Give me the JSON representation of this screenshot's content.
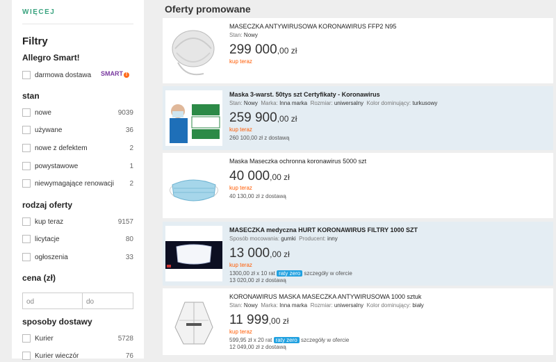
{
  "sidebar": {
    "more_link": "WIĘCEJ",
    "filters_title": "Filtry",
    "smart": {
      "title": "Allegro Smart!",
      "free_delivery_label": "darmowa dostawa",
      "smart_badge": "SMART",
      "smart_badge_mark": "!"
    },
    "condition": {
      "title": "stan",
      "items": [
        {
          "label": "nowe",
          "count": "9039"
        },
        {
          "label": "używane",
          "count": "36"
        },
        {
          "label": "nowe z defektem",
          "count": "2"
        },
        {
          "label": "powystawowe",
          "count": "1"
        },
        {
          "label": "niewymagające renowacji",
          "count": "2"
        }
      ]
    },
    "offer_type": {
      "title": "rodzaj oferty",
      "items": [
        {
          "label": "kup teraz",
          "count": "9157"
        },
        {
          "label": "licytacje",
          "count": "80"
        },
        {
          "label": "ogłoszenia",
          "count": "33"
        }
      ]
    },
    "price": {
      "title": "cena (zł)",
      "from_placeholder": "od",
      "to_placeholder": "do",
      "separator": "-"
    },
    "delivery": {
      "title": "sposoby dostawy",
      "items": [
        {
          "label": "Kurier",
          "count": "5728"
        },
        {
          "label": "Kurier wieczór",
          "count": "76"
        }
      ]
    }
  },
  "main": {
    "title": "Oferty promowane",
    "offers": [
      {
        "title": "MASECZKA ANTYWIRUSOWA KORONAWIRUS FFP2 N95",
        "attrs": [
          {
            "k": "Stan:",
            "v": "Nowy"
          }
        ],
        "price_main": "299 000",
        "price_rest": ",00 zł",
        "buy_now": "kup teraz"
      },
      {
        "title": "Maska 3-warst. 50tys szt Certyfikaty - Koronawirus",
        "attrs": [
          {
            "k": "Stan:",
            "v": "Nowy"
          },
          {
            "k": "Marka:",
            "v": "Inna marka"
          },
          {
            "k": "Rozmiar:",
            "v": "uniwersalny"
          },
          {
            "k": "Kolor dominujący:",
            "v": "turkusowy"
          }
        ],
        "price_main": "259 900",
        "price_rest": ",00 zł",
        "buy_now": "kup teraz",
        "delivery": "260 100,00 zł z dostawą"
      },
      {
        "title": "Maska Maseczka ochronna koronawirus 5000 szt",
        "price_main": "40 000",
        "price_rest": ",00 zł",
        "buy_now": "kup teraz",
        "delivery": "40 130,00 zł z dostawą"
      },
      {
        "title": "MASECZKA medyczna HURT KORONAWIRUS FILTRY 1000 SZT",
        "attrs": [
          {
            "k": "Sposób mocowania:",
            "v": "gumki"
          },
          {
            "k": "Producent:",
            "v": "inny"
          }
        ],
        "price_main": "13 000",
        "price_rest": ",00 zł",
        "buy_now": "kup teraz",
        "installment": "1300,00 zł x 10 rat",
        "installment_badge": "raty zero",
        "installment_details": "szczegóły w ofercie",
        "delivery": "13 020,00 zł z dostawą"
      },
      {
        "title": "KORONAWIRUS MASKA MASECZKA ANTYWIRUSOWA 1000 sztuk",
        "attrs": [
          {
            "k": "Stan:",
            "v": "Nowy"
          },
          {
            "k": "Marka:",
            "v": "Inna marka"
          },
          {
            "k": "Rozmiar:",
            "v": "uniwersalny"
          },
          {
            "k": "Kolor dominujący:",
            "v": "biały"
          }
        ],
        "price_main": "11 999",
        "price_rest": ",00 zł",
        "buy_now": "kup teraz",
        "installment": "599,95 zł x 20 rat",
        "installment_badge": "raty zero",
        "installment_details": "szczegóły w ofercie",
        "delivery": "12 049,00 zł z dostawą"
      }
    ]
  },
  "colors": {
    "accent_green": "#3aa37f",
    "buy_now_orange": "#ff5a00",
    "badge_blue": "#21a1e0",
    "smart_purple": "#7a3ba0",
    "highlight_row": "#e4edf3"
  }
}
